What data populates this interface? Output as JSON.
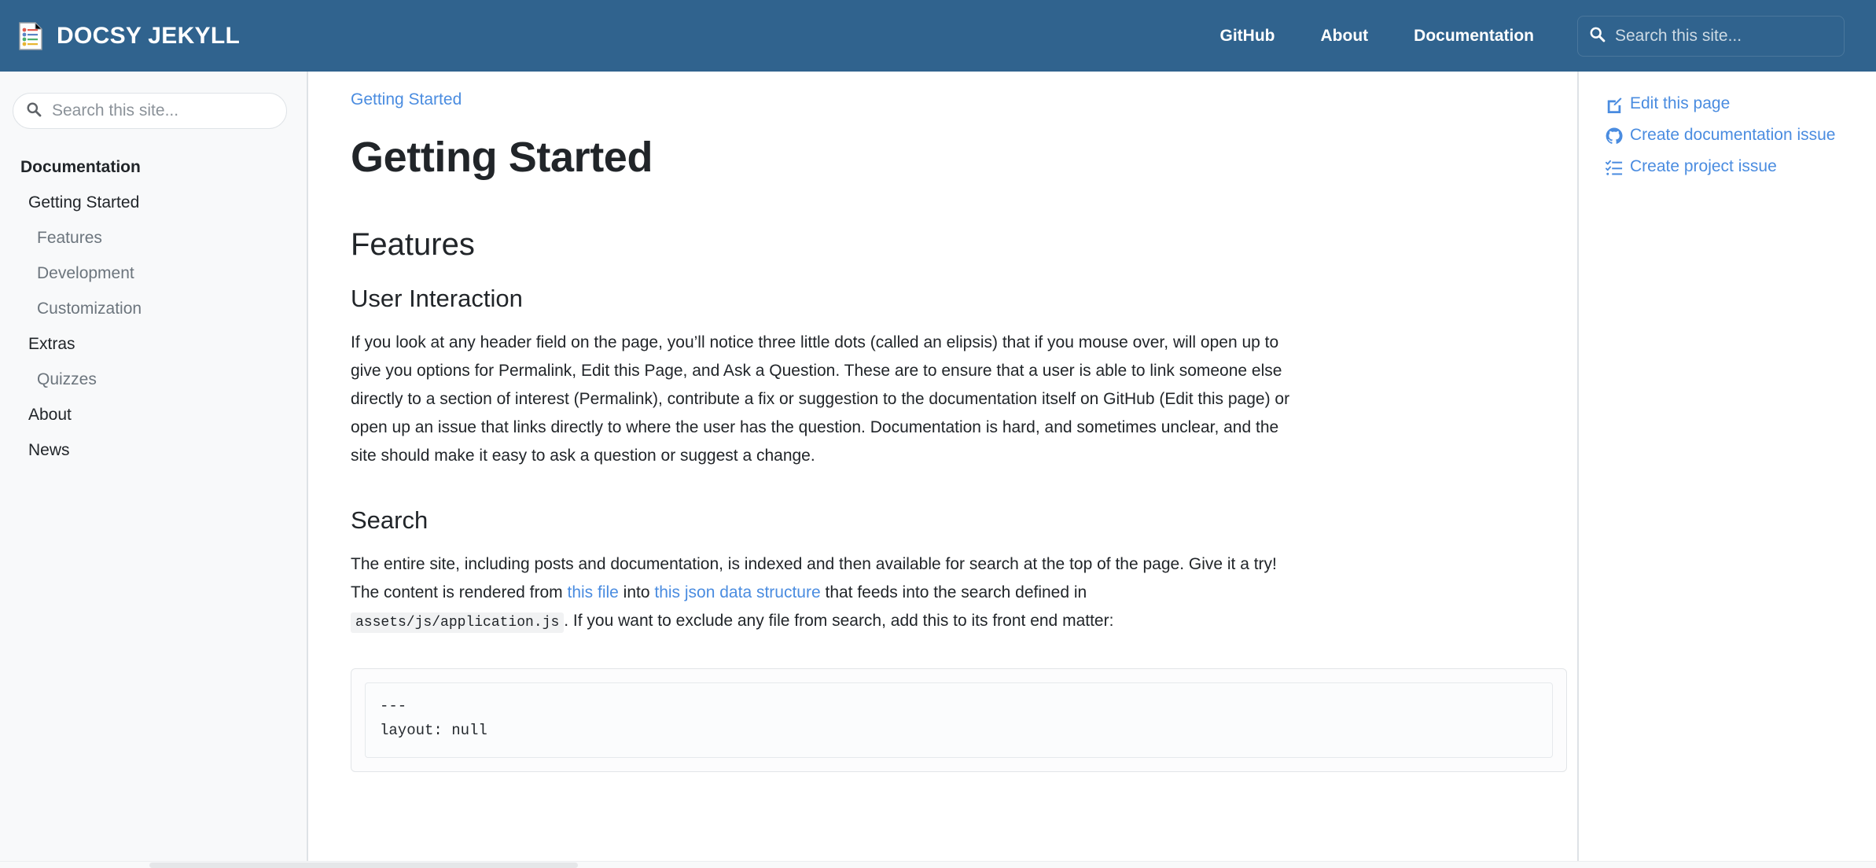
{
  "navbar": {
    "brand_title": "DOCSY JEKYLL",
    "brand_icon": "document-list-icon",
    "links": [
      {
        "label": "GitHub",
        "name": "nav-link-github"
      },
      {
        "label": "About",
        "name": "nav-link-about"
      },
      {
        "label": "Documentation",
        "name": "nav-link-documentation"
      }
    ],
    "search": {
      "placeholder": "Search this site...",
      "value": "",
      "icon": "search-icon"
    },
    "background_color": "#30638e"
  },
  "sidebar": {
    "search": {
      "placeholder": "Search this site...",
      "value": "",
      "icon": "search-icon"
    },
    "items": [
      {
        "label": "Documentation",
        "level": 0
      },
      {
        "label": "Getting Started",
        "level": 1
      },
      {
        "label": "Features",
        "level": 2
      },
      {
        "label": "Development",
        "level": 2
      },
      {
        "label": "Customization",
        "level": 2
      },
      {
        "label": "Extras",
        "level": 1
      },
      {
        "label": "Quizzes",
        "level": 2
      },
      {
        "label": "About",
        "level": 1
      },
      {
        "label": "News",
        "level": 1
      }
    ]
  },
  "main": {
    "breadcrumb": "Getting Started",
    "title": "Getting Started",
    "features_heading": "Features",
    "user_interaction_heading": "User Interaction",
    "user_interaction_paragraph": "If you look at any header field on the page, you’ll notice three little dots (called an elipsis) that if you mouse over, will open up to give you options for Permalink, Edit this Page, and Ask a Question. These are to ensure that a user is able to link someone else directly to a section of interest (Permalink), contribute a fix or suggestion to the documentation itself on GitHub (Edit this page) or open up an issue that links directly to where the user has the question. Documentation is hard, and sometimes unclear, and the site should make it easy to ask a question or suggest a change.",
    "search_heading": "Search",
    "search_paragraph": {
      "part1": "The entire site, including posts and documentation, is indexed and then available for search at the top of the page. Give it a try! The content is rendered from ",
      "link1": "this file",
      "part2": " into ",
      "link2": "this json data structure",
      "part3": " that feeds into the search defined in ",
      "code": "assets/js/application.js",
      "part4": ". If you want to exclude any file from search, add this to its front end matter:"
    },
    "code_block": "---\nlayout: null"
  },
  "rightbar": {
    "links": [
      {
        "label": "Edit this page",
        "icon": "edit-pencil-square-icon",
        "name": "edit-this-page-link"
      },
      {
        "label": "Create documentation issue",
        "icon": "github-icon",
        "name": "create-documentation-issue-link"
      },
      {
        "label": "Create project issue",
        "icon": "task-list-icon",
        "name": "create-project-issue-link"
      }
    ],
    "link_color": "#4a8ce0"
  }
}
